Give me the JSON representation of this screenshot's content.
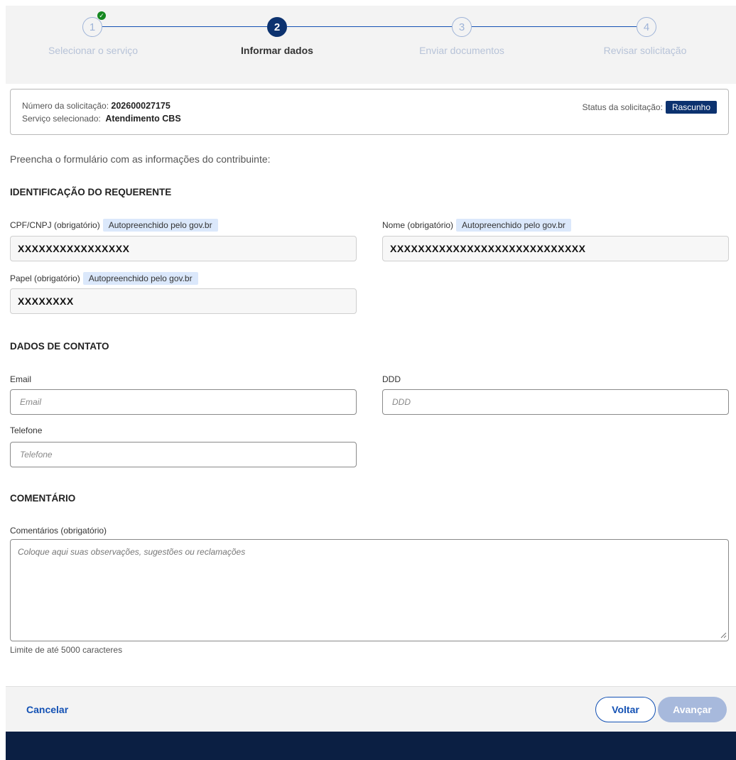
{
  "stepper": {
    "steps": [
      {
        "number": "1",
        "label": "Selecionar o serviço",
        "state": "done"
      },
      {
        "number": "2",
        "label": "Informar dados",
        "state": "active"
      },
      {
        "number": "3",
        "label": "Enviar documentos",
        "state": "pending"
      },
      {
        "number": "4",
        "label": "Revisar solicitação",
        "state": "pending"
      }
    ],
    "check_glyph": "✓"
  },
  "request": {
    "number_label": "Número da solicitação:",
    "number_value": "202600027175",
    "service_label": "Serviço selecionado:",
    "service_value": "Atendimento CBS",
    "status_label": "Status da solicitação:",
    "status_value": "Rascunho"
  },
  "intro": "Preencha o formulário com as informações do contribuinte:",
  "identificacao": {
    "title": "IDENTIFICAÇÃO DO REQUERENTE",
    "auto_badge": "Autopreenchido pelo gov.br",
    "cpf_label": "CPF/CNPJ (obrigatório)",
    "cpf_value": "XXXXXXXXXXXXXXXX",
    "nome_label": "Nome (obrigatório)",
    "nome_value": "XXXXXXXXXXXXXXXXXXXXXXXXXXXX",
    "papel_label": "Papel (obrigatório)",
    "papel_value": "XXXXXXXX"
  },
  "contato": {
    "title": "DADOS DE CONTATO",
    "email_label": "Email",
    "email_placeholder": "Email",
    "ddd_label": "DDD",
    "ddd_placeholder": "DDD",
    "telefone_label": "Telefone",
    "telefone_placeholder": "Telefone"
  },
  "comentario": {
    "title": "COMENTÁRIO",
    "label": "Comentários (obrigatório)",
    "placeholder": "Coloque aqui suas observações, sugestões ou reclamações",
    "limit": "Limite de até 5000 caracteres"
  },
  "footer": {
    "cancel": "Cancelar",
    "back": "Voltar",
    "next": "Avançar"
  },
  "colors": {
    "primary": "#1351b4",
    "dark_blue": "#0c326f",
    "success": "#168821",
    "bottom_band": "#0b1f43"
  }
}
